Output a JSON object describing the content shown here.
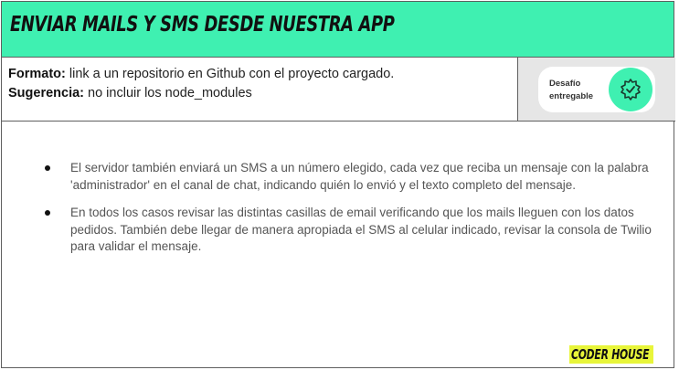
{
  "header": {
    "title": "ENVIAR MAILS Y SMS DESDE NUESTRA APP"
  },
  "info": {
    "format_label": "Formato:",
    "format_value": " link a un repositorio en Github con el proyecto cargado.",
    "suggestion_label": "Sugerencia:",
    "suggestion_value": " no incluir los node_modules"
  },
  "badge": {
    "line1": "Desafío",
    "line2": "entregable",
    "icon": "leaf-check-icon",
    "color": "#3ff0b1"
  },
  "bullets": [
    "El servidor también enviará un SMS a un número elegido, cada vez que reciba un mensaje con la palabra 'administrador' en el canal de chat, indicando quién lo envió y el texto completo del mensaje.",
    "En todos los casos revisar las distintas casillas de email verificando que los mails lleguen con los datos pedidos. También debe llegar de manera apropiada el SMS al celular indicado, revisar la consola de Twilio para validar el mensaje."
  ],
  "logo": {
    "text": "CODER HOUSE",
    "color": "#e8f53a"
  },
  "colors": {
    "accent": "#3ff0b1",
    "border": "#5f5f5f"
  }
}
